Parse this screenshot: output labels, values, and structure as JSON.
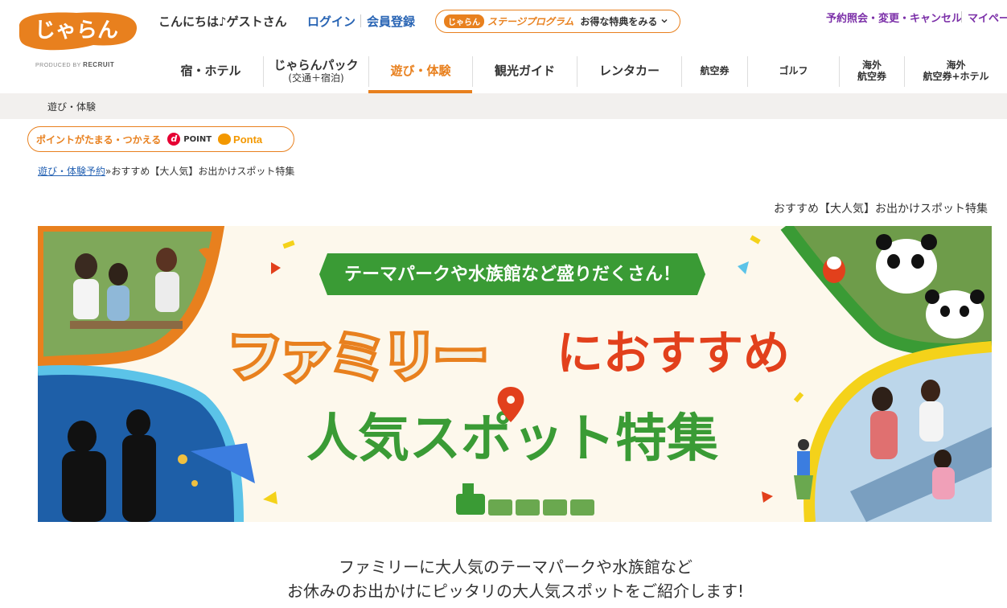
{
  "header": {
    "logo_text": "じゃらん",
    "produced_by": "PRODUCED BY",
    "produced_brand": "RECRUIT",
    "greeting": "こんにちは♪ゲストさん",
    "login": "ログイン",
    "register": "会員登録",
    "stage_badge": "じゃらん",
    "stage_title": "ステージプログラム",
    "stage_link": "お得な特典をみる",
    "reserve": "予約照会・変更・キャンセル",
    "mypage": "マイペー"
  },
  "nav": {
    "items": [
      {
        "label": "宿・ホテル",
        "sub": ""
      },
      {
        "label": "じゃらんパック",
        "sub": "(交通＋宿泊)"
      },
      {
        "label": "遊び・体験",
        "sub": ""
      },
      {
        "label": "観光ガイド",
        "sub": ""
      },
      {
        "label": "レンタカー",
        "sub": ""
      },
      {
        "label": "航空券",
        "sub": ""
      },
      {
        "label": "ゴルフ",
        "sub": ""
      },
      {
        "label": "海外",
        "sub": "航空券"
      },
      {
        "label": "海外",
        "sub": "航空券+ホテル"
      }
    ]
  },
  "subbar": {
    "label": "遊び・体験"
  },
  "points": {
    "text": "ポイントがたまる・つかえる",
    "dpoint_mark": "d",
    "dpoint_label": "POINT",
    "ponta_label": "Ponta"
  },
  "breadcrumb": {
    "link": "遊び・体験予約",
    "separator": "»",
    "current": "おすすめ【大人気】お出かけスポット特集"
  },
  "page_heading": "おすすめ【大人気】お出かけスポット特集",
  "banner": {
    "ribbon": "テーマパークや水族館など盛りだくさん！",
    "title_orange": "ファミリー",
    "title_red": "におすすめ",
    "title_green": "人気スポット特集"
  },
  "intro": {
    "line1": "ファミリーに大人気のテーマパークや水族館など",
    "line2": "お休みのお出かけにピッタリの大人気スポットをご紹介します!"
  },
  "colors": {
    "accent": "#e8801e",
    "link": "#2864b4",
    "purple": "#7b2fa8",
    "green": "#3a9b35",
    "red": "#e2401c"
  }
}
